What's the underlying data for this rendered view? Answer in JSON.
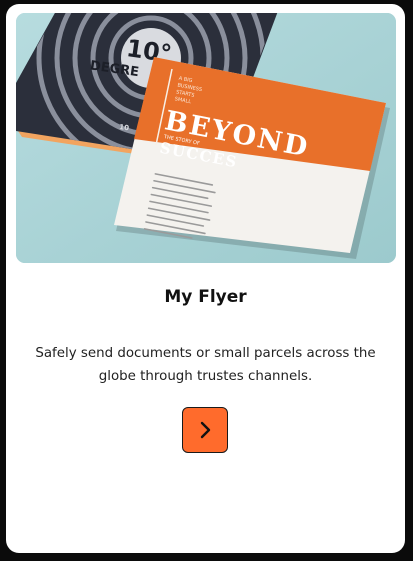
{
  "card": {
    "title": "My Flyer",
    "description": "Safely send documents or small parcels across the globe through trustes channels.",
    "button_icon": "chevron-right-icon",
    "button_color": "#ff6b2c"
  },
  "image": {
    "back_cover": {
      "number": "10°",
      "word": "DEGRE"
    },
    "front_cover": {
      "tagline_lines": [
        "A BIG",
        "BUSINESS",
        "STARTS",
        "SMALL"
      ],
      "headline": "BEYOND",
      "subline_small": "THE STORY OF",
      "subline": "SUCCES",
      "accent_color": "#e8702a"
    }
  }
}
